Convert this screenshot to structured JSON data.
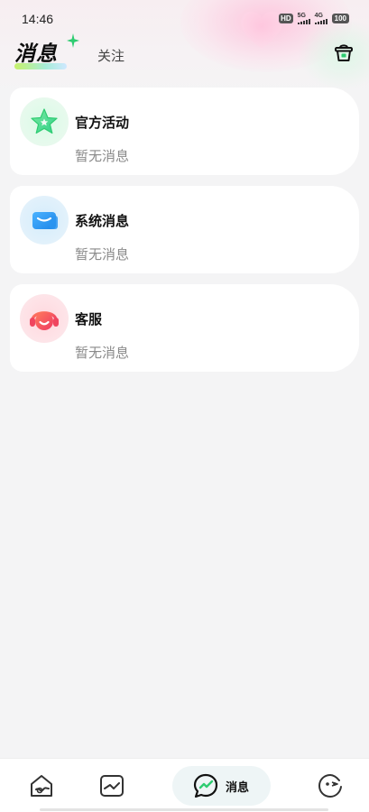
{
  "status_bar": {
    "time": "14:46",
    "hd": "HD",
    "signal_1": "5G",
    "signal_2": "4G",
    "battery": "100"
  },
  "header": {
    "title": "消息",
    "tab_follow": "关注",
    "clean_icon": "basket-clean-icon"
  },
  "messages": [
    {
      "title": "官方活动",
      "preview": "暂无消息",
      "icon": "star-icon",
      "color": "#4fd98a"
    },
    {
      "title": "系统消息",
      "preview": "暂无消息",
      "icon": "mail-icon",
      "color": "#2f9bf0"
    },
    {
      "title": "客服",
      "preview": "暂无消息",
      "icon": "headset-icon",
      "color": "#f04b4b"
    }
  ],
  "bottom_nav": {
    "items": [
      {
        "icon": "home-icon"
      },
      {
        "icon": "discover-icon"
      },
      {
        "icon": "chat-icon",
        "label": "消息",
        "active": true
      },
      {
        "icon": "profile-icon"
      }
    ]
  },
  "colors": {
    "accent_green": "#2ecc71",
    "background": "#f4f4f5",
    "muted_text": "#8a8a8a"
  }
}
